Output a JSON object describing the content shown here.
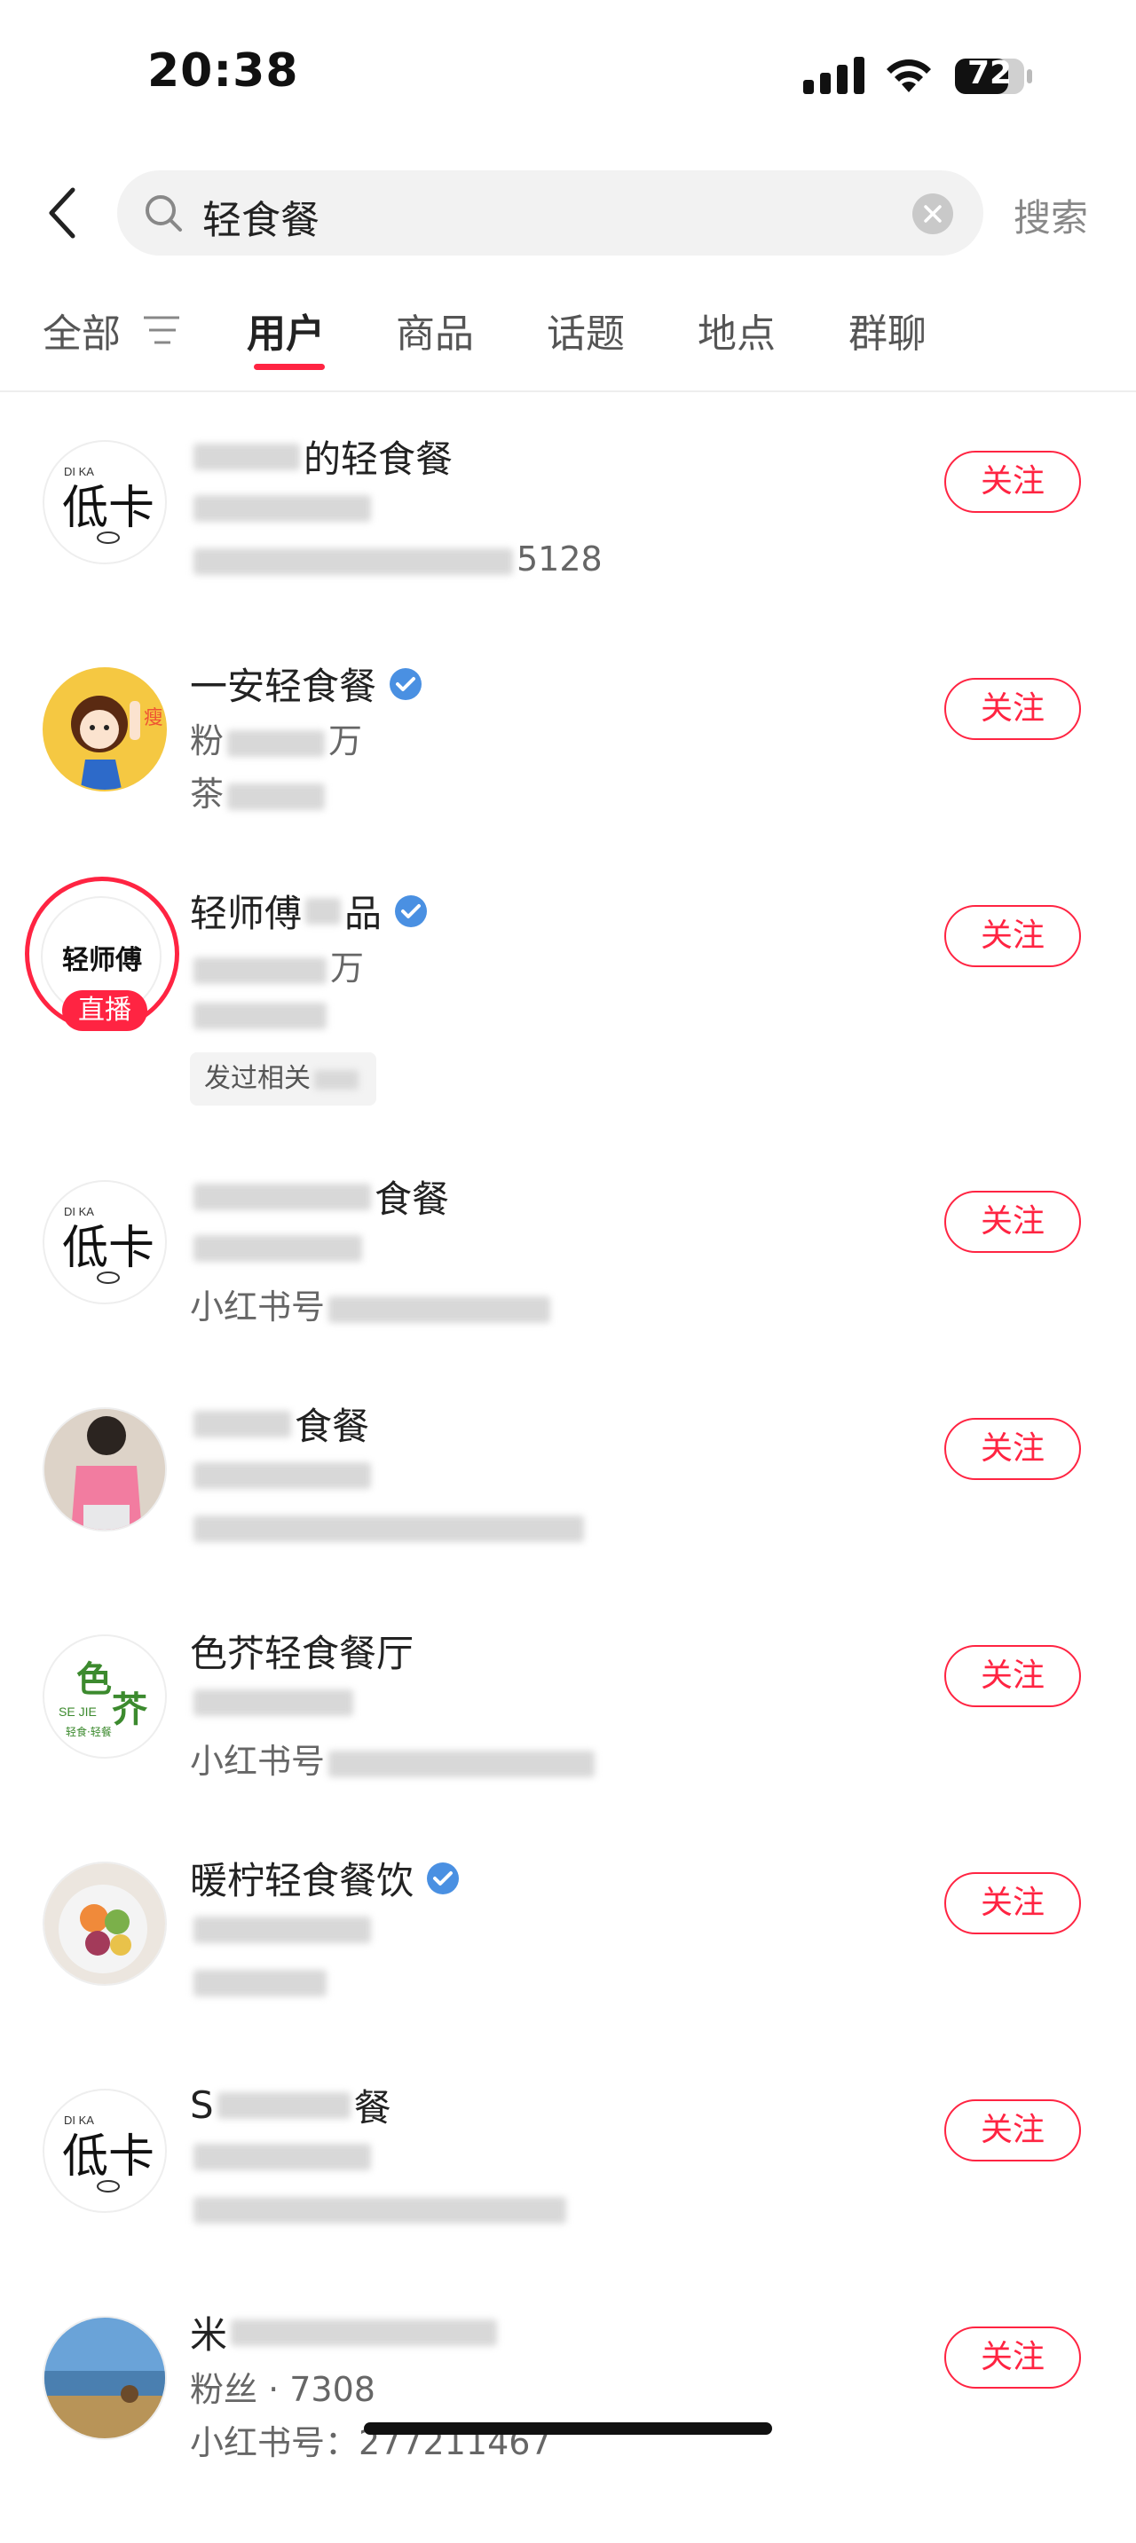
{
  "status_bar": {
    "time": "20:38",
    "battery": "72"
  },
  "search": {
    "query": "轻食餐",
    "search_label": "搜索"
  },
  "tabs": [
    {
      "label": "全部"
    },
    {
      "label": "用户"
    },
    {
      "label": "商品"
    },
    {
      "label": "话题"
    },
    {
      "label": "地点"
    },
    {
      "label": "群聊"
    }
  ],
  "results": [
    {
      "name_visible": "的轻食餐",
      "fans_label": "",
      "extra_suffix": "5128",
      "avatar": "dika-logo-icon",
      "follow": "关注"
    },
    {
      "name_visible": "一安轻食餐",
      "fans_visible": "粉",
      "fans_suffix": "万",
      "extra_visible": "茶",
      "avatar": "cartoon-girl-avatar",
      "verified": true,
      "follow": "关注"
    },
    {
      "name_visible": "轻师傅",
      "name_suffix": "品",
      "fans_suffix": "万",
      "extra_visible": "",
      "tag": "发过相关",
      "live": "直播",
      "verified": true,
      "avatar": "qingshifu-logo-icon",
      "follow": "关注"
    },
    {
      "name_visible": "食餐",
      "extra_visible": "小红书号",
      "avatar": "dika-logo-icon",
      "follow": "关注"
    },
    {
      "name_visible": "食餐",
      "avatar": "pink-shirt-photo",
      "follow": "关注"
    },
    {
      "name_visible": "色芥轻食餐厅",
      "extra_visible": "小红书号",
      "avatar": "sejie-logo-icon",
      "follow": "关注"
    },
    {
      "name_visible": "暖柠轻食餐饮",
      "verified": true,
      "avatar": "salad-bowl-photo",
      "follow": "关注"
    },
    {
      "name_visible": "S",
      "name_suffix": "餐",
      "avatar": "dika-logo-icon",
      "follow": "关注"
    },
    {
      "name_visible": "米",
      "fans_visible": "粉丝 · 7308",
      "extra_visible": "小红书号：",
      "extra_suffix": "277211467",
      "avatar": "landscape-photo",
      "follow": "关注"
    }
  ],
  "colors": {
    "accent": "#ff2442",
    "verified": "#4a90e2"
  }
}
